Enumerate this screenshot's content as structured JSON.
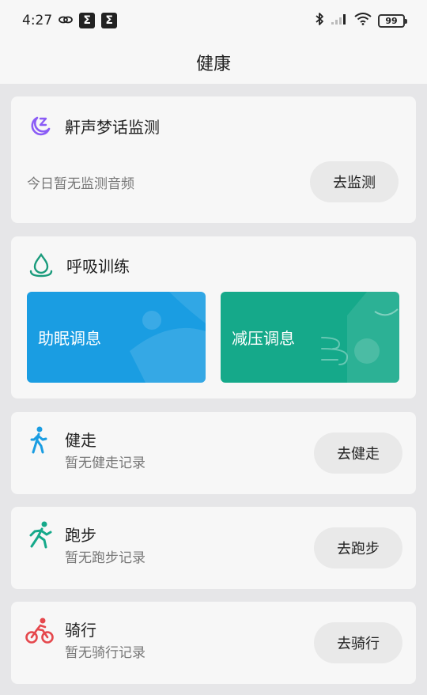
{
  "status_bar": {
    "time": "4:27",
    "sigma_1": "Σ",
    "sigma_2": "Σ",
    "battery": "99"
  },
  "header": {
    "title": "健康"
  },
  "snore_card": {
    "title": "鼾声梦话监测",
    "status": "今日暂无监测音频",
    "button": "去监测",
    "icon": "moon-z-icon",
    "icon_color": "#8b5cf6"
  },
  "breath_card": {
    "title": "呼吸训练",
    "icon": "water-drop-icon",
    "icon_color": "#1a9b7c",
    "tiles": [
      {
        "label": "助眠调息",
        "color": "#1a9de2"
      },
      {
        "label": "减压调息",
        "color": "#15a98a"
      }
    ]
  },
  "activities": [
    {
      "title": "健走",
      "status": "暂无健走记录",
      "button": "去健走",
      "icon": "walking-icon",
      "color": "#1a9de2"
    },
    {
      "title": "跑步",
      "status": "暂无跑步记录",
      "button": "去跑步",
      "icon": "running-icon",
      "color": "#15a98a"
    },
    {
      "title": "骑行",
      "status": "暂无骑行记录",
      "button": "去骑行",
      "icon": "cycling-icon",
      "color": "#e5484d"
    }
  ]
}
